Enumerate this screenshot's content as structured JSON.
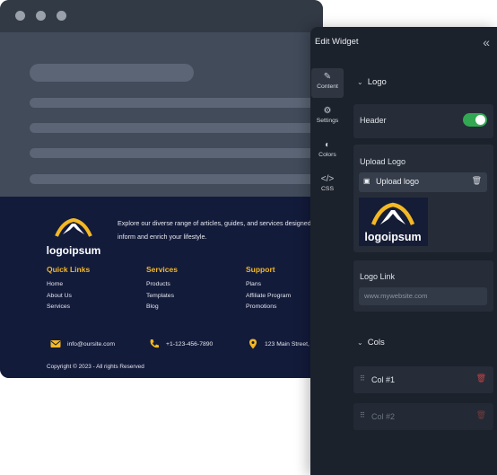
{
  "preview": {
    "footer": {
      "logo_text": "logoipsum",
      "tagline": "Explore our diverse range of articles, guides, and services designed to inform and enrich your lifestyle.",
      "columns": [
        {
          "title": "Quick Links",
          "links": [
            "Home",
            "About Us",
            "Services"
          ]
        },
        {
          "title": "Services",
          "links": [
            "Products",
            "Templates",
            "Blog"
          ]
        },
        {
          "title": "Support",
          "links": [
            "Plans",
            "Affiliate Program",
            "Promotions"
          ]
        }
      ],
      "contact": {
        "email": "info@oursite.com",
        "phone": "+1-123-456-7890",
        "address": "123 Main Street,"
      },
      "copyright": "Copyright © 2023 - All rights Reserved",
      "accent_color": "#f4b823"
    }
  },
  "panel": {
    "title": "Edit Widget",
    "collapse_icon": "«",
    "tabs": [
      {
        "label": "Content",
        "icon": "✎"
      },
      {
        "label": "Settings",
        "icon": "⚙"
      },
      {
        "label": "Colors",
        "icon": "◐"
      },
      {
        "label": "CSS",
        "icon": "</>"
      }
    ],
    "logo_section": {
      "title": "Logo",
      "header_label": "Header",
      "header_enabled": true,
      "upload_label": "Upload Logo",
      "upload_button": "Upload logo",
      "logo_link_label": "Logo Link",
      "logo_link_placeholder": "www.mywebsite.com"
    },
    "cols_section": {
      "title": "Cols",
      "items": [
        "Col #1",
        "Col #2"
      ]
    },
    "toggle_color": "#32a852",
    "delete_color": "#d23d3d"
  }
}
